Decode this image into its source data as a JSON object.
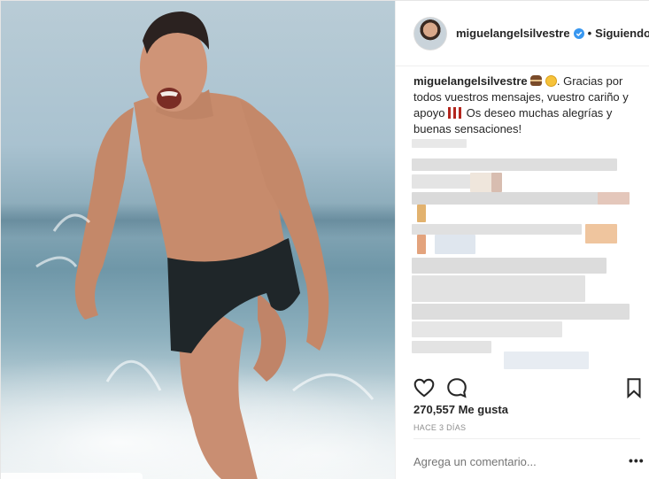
{
  "post": {
    "username": "miguelangelsilvestre",
    "follow_separator": "•",
    "follow_status": "Siguiendo",
    "caption_user": "miguelangelsilvestre",
    "caption_text_1": ". Gracias por todos vuestros mensajes, vuestro cariño y apoyo",
    "caption_text_2": " Os deseo muchas alegrías y buenas sensaciones!",
    "likes": "270,557 Me gusta",
    "time_ago": "HACE 3 DÍAS",
    "comment_placeholder": "Agrega un comentario...",
    "more_label": "•••"
  },
  "icons": {
    "like": "heart-icon",
    "comment": "speech-bubble-icon",
    "save": "bookmark-icon",
    "verified": "verified-badge-icon"
  },
  "colors": {
    "verified": "#3897f0",
    "text": "#262626",
    "muted": "#8e8e8e"
  }
}
